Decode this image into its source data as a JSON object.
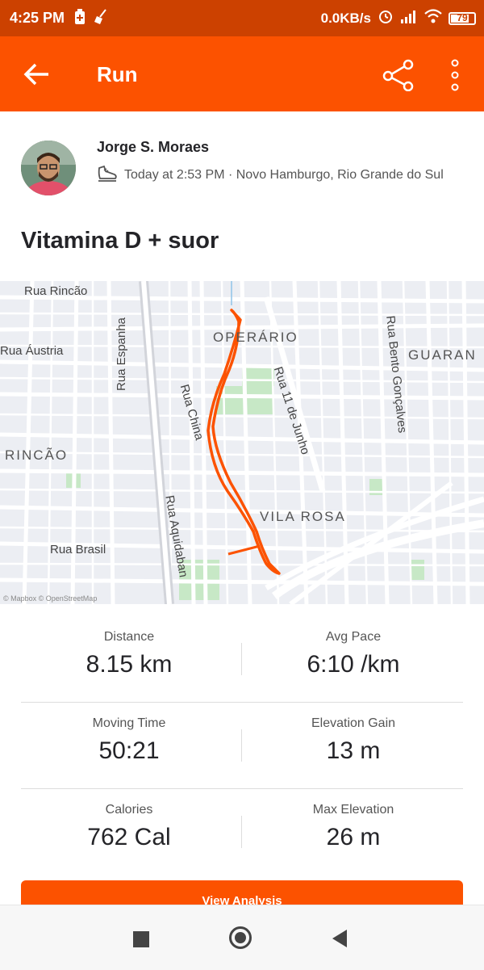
{
  "status_bar": {
    "time": "4:25 PM",
    "left_icons": [
      "battery-saver-icon",
      "cleaner-broom-icon"
    ],
    "network_speed": "0.0KB/s",
    "right_icons": [
      "alarm-icon",
      "signal-icon",
      "wifi-icon"
    ],
    "battery_level": "79"
  },
  "app_bar": {
    "title": "Run",
    "icons": [
      "back-arrow-icon",
      "share-icon",
      "more-vertical-icon"
    ]
  },
  "activity": {
    "athlete_name": "Jorge S. Moraes",
    "meta": "Today at 2:53 PM · Novo Hamburgo, Rio Grande do Sul",
    "title": "Vitamina D + suor"
  },
  "map": {
    "labels": {
      "rua_rincao": "Rua Rincão",
      "operario": "OPERÁRIO",
      "rua_bento": "Rua Bento Gonçalves",
      "guarani": "GUARAN",
      "rua_austria": "Rua Áustria",
      "rua_espanha": "Rua Espanha",
      "rua_china": "Rua China",
      "rua_11_junho": "Rua 11 de Junho",
      "rincao": "RINCÃO",
      "vila_rosa": "VILA ROSA",
      "rua_aquidaban": "Rua Aquidaban",
      "rua_brasil": "Rua Brasil"
    },
    "attribution": "© Mapbox © OpenStreetMap",
    "route_color": "#fc5200"
  },
  "stats": [
    {
      "label": "Distance",
      "value": "8.15 km"
    },
    {
      "label": "Avg Pace",
      "value": "6:10 /km"
    },
    {
      "label": "Moving Time",
      "value": "50:21"
    },
    {
      "label": "Elevation Gain",
      "value": "13 m"
    },
    {
      "label": "Calories",
      "value": "762 Cal"
    },
    {
      "label": "Max Elevation",
      "value": "26 m"
    }
  ],
  "view_analysis_label": "View Analysis",
  "nav_bar": {
    "icons": [
      "recents-square-icon",
      "home-circle-icon",
      "back-triangle-icon"
    ]
  },
  "colors": {
    "brand": "#fc5200",
    "status_bar": "#cc4100"
  }
}
